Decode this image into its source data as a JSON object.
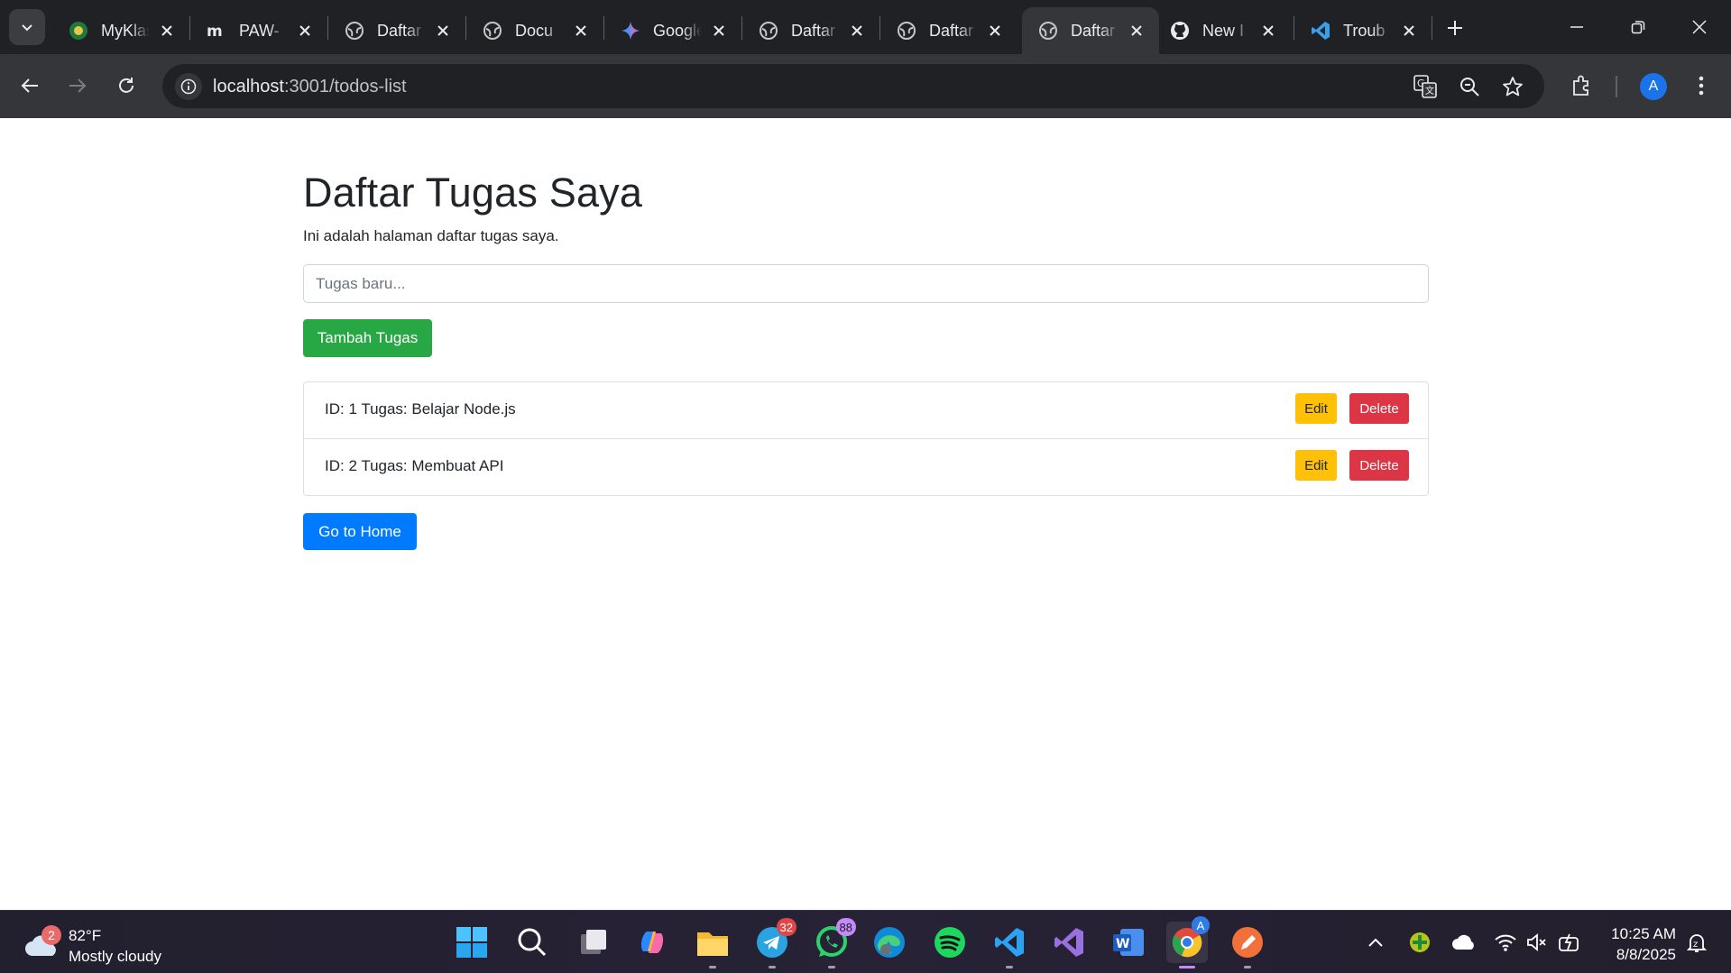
{
  "browser": {
    "tabs": [
      {
        "label": "MyKlass",
        "icon": "myklass-favicon",
        "active": false
      },
      {
        "label": "PAW-",
        "icon": "moodle-favicon",
        "active": false
      },
      {
        "label": "Daftar",
        "icon": "globe-favicon",
        "active": false
      },
      {
        "label": "Docu",
        "icon": "globe-favicon",
        "active": false
      },
      {
        "label": "Google",
        "icon": "gemini-favicon",
        "active": false
      },
      {
        "label": "Daftar",
        "icon": "globe-favicon",
        "active": false
      },
      {
        "label": "Daftar",
        "icon": "globe-favicon",
        "active": false
      },
      {
        "label": "Daftar",
        "icon": "globe-favicon",
        "active": true
      },
      {
        "label": "New I",
        "icon": "github-favicon",
        "active": false
      },
      {
        "label": "Troub",
        "icon": "vscode-favicon",
        "active": false
      }
    ],
    "url_host": "localhost",
    "url_path": ":3001/todos-list",
    "profile_initial": "A"
  },
  "page": {
    "title": "Daftar Tugas Saya",
    "subtitle": "Ini adalah halaman daftar tugas saya.",
    "input_placeholder": "Tugas baru...",
    "add_button": "Tambah Tugas",
    "todos": [
      {
        "text": "ID: 1 Tugas: Belajar Node.js",
        "edit_label": "Edit",
        "delete_label": "Delete"
      },
      {
        "text": "ID: 2 Tugas: Membuat API",
        "edit_label": "Edit",
        "delete_label": "Delete"
      }
    ],
    "home_button": "Go to Home"
  },
  "taskbar": {
    "weather_badge": "2",
    "weather_temp": "82°F",
    "weather_condition": "Mostly cloudy",
    "telegram_badge": "32",
    "whatsapp_badge": "88",
    "chrome_badge": "A",
    "time": "10:25 AM",
    "date": "8/8/2025"
  },
  "colors": {
    "success": "#28a745",
    "primary": "#007bff",
    "warning": "#ffc107",
    "danger": "#dc3545"
  }
}
